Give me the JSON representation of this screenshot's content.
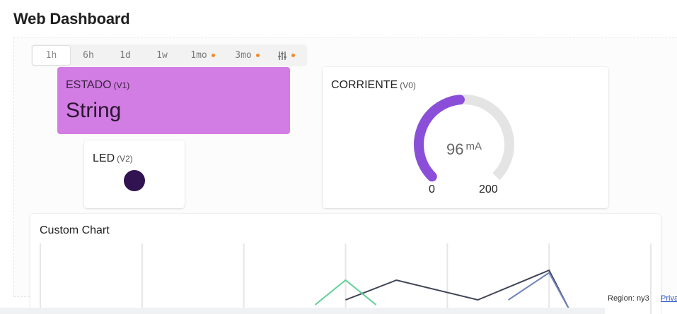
{
  "header": {
    "title": "Web Dashboard"
  },
  "time_tabs": [
    {
      "label": "1h",
      "active": true,
      "dot": false
    },
    {
      "label": "6h",
      "active": false,
      "dot": false
    },
    {
      "label": "1d",
      "active": false,
      "dot": false
    },
    {
      "label": "1w",
      "active": false,
      "dot": false
    },
    {
      "label": "1mo",
      "active": false,
      "dot": true
    },
    {
      "label": "3mo",
      "active": false,
      "dot": true
    },
    {
      "label": "",
      "icon": "sliders-icon",
      "active": false,
      "dot": true
    }
  ],
  "widgets": {
    "estado": {
      "title": "ESTADO",
      "pin": "(V1)",
      "value": "String",
      "color": "#d27de3"
    },
    "led": {
      "title": "LED",
      "pin": "(V2)",
      "color": "#301350"
    },
    "corriente": {
      "title": "CORRIENTE",
      "pin": "(V0)",
      "value": "96",
      "unit": "mA",
      "min": "0",
      "max": "200",
      "gauge_value": 96,
      "gauge_min": 0,
      "gauge_max": 200,
      "fill_color": "#8a4ed8",
      "track_color": "#e4e4e4"
    },
    "chart": {
      "title": "Custom Chart"
    }
  },
  "chart_data": {
    "type": "line",
    "title": "Custom Chart",
    "grid": "vertical",
    "series": [
      {
        "color": "#3f4357",
        "x": [
          3.0,
          3.5,
          4.3,
          5.0,
          5.2
        ],
        "y": [
          0.2,
          0.6,
          0.2,
          0.8,
          0.0
        ]
      },
      {
        "color": "#5fcf98",
        "x": [
          2.7,
          3.0,
          3.3
        ],
        "y": [
          0.1,
          0.6,
          0.1
        ]
      },
      {
        "color": "#6f82bd",
        "x": [
          4.6,
          5.0,
          5.2
        ],
        "y": [
          0.2,
          0.75,
          0.0
        ]
      }
    ]
  },
  "footer": {
    "region": "Region: ny3",
    "privacy": "Priva"
  }
}
